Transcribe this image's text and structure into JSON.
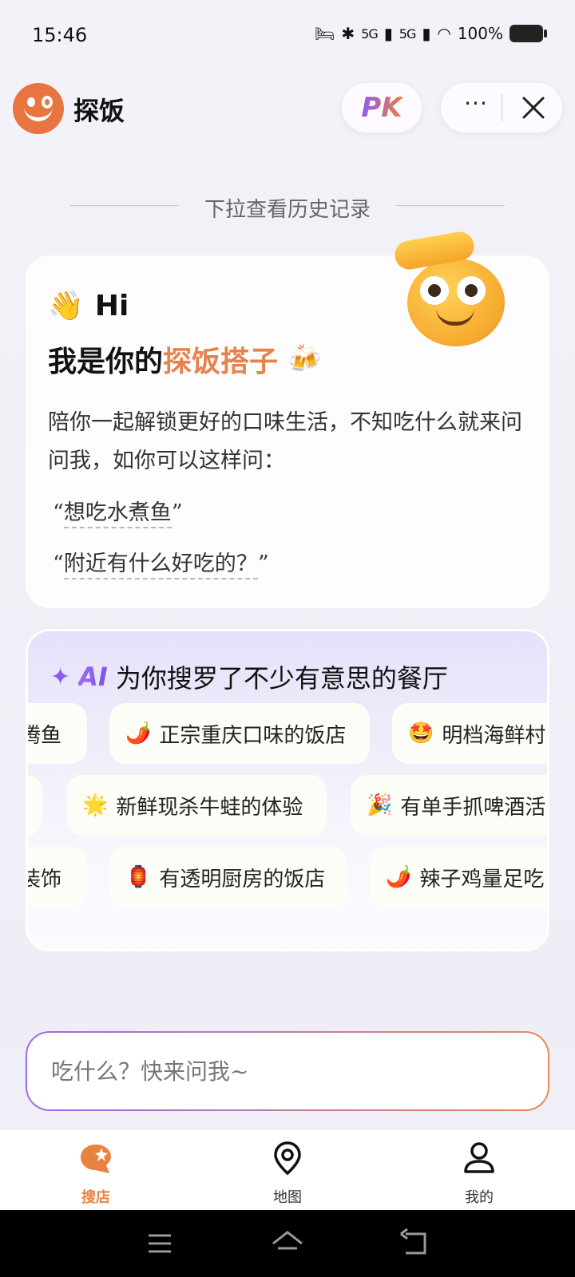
{
  "status_bar": {
    "time": "15:46",
    "network1": "5G",
    "network2": "5G",
    "battery": "100%"
  },
  "header": {
    "app_name": "探饭",
    "pk_label": "PK",
    "more_label": "···"
  },
  "pull_hint": "下拉查看历史记录",
  "welcome": {
    "wave_emoji": "👋",
    "hi": "Hi",
    "line_prefix": "我是你的",
    "line_accent": "探饭搭子",
    "cheers_emoji": "🍻",
    "intro": "陪你一起解锁更好的口味生活，不知吃什么就来问问我，如你可以这样问：",
    "example1": "想吃水煮鱼",
    "example2": "附近有什么好吃的？",
    "quote_open": "“",
    "quote_close": "”"
  },
  "ai_panel": {
    "sparkle": "✦",
    "ai_label": "AI",
    "title": "为你搜罗了不少有意思的餐厅",
    "rows": [
      [
        {
          "emoji": "",
          "text": "腾鱼"
        },
        {
          "emoji": "🌶️",
          "text": "正宗重庆口味的饭店"
        },
        {
          "emoji": "🤩",
          "text": "明档海鲜村"
        }
      ],
      [
        {
          "emoji": "",
          "text": ""
        },
        {
          "emoji": "🌟",
          "text": "新鲜现杀牛蛙的体验"
        },
        {
          "emoji": "🎉",
          "text": "有单手抓啤酒活"
        }
      ],
      [
        {
          "emoji": "",
          "text": "装饰"
        },
        {
          "emoji": "🏮",
          "text": "有透明厨房的饭店"
        },
        {
          "emoji": "🌶️",
          "text": "辣子鸡量足吃"
        }
      ]
    ]
  },
  "search": {
    "placeholder": "吃什么？快来问我~"
  },
  "bottom_nav": {
    "items": [
      {
        "label": "搜店",
        "icon": "search-shop-icon",
        "active": true
      },
      {
        "label": "地图",
        "icon": "map-pin-icon",
        "active": false
      },
      {
        "label": "我的",
        "icon": "profile-icon",
        "active": false
      }
    ]
  },
  "colors": {
    "accent_orange": "#e8824b",
    "accent_purple": "#8a5cf0"
  }
}
